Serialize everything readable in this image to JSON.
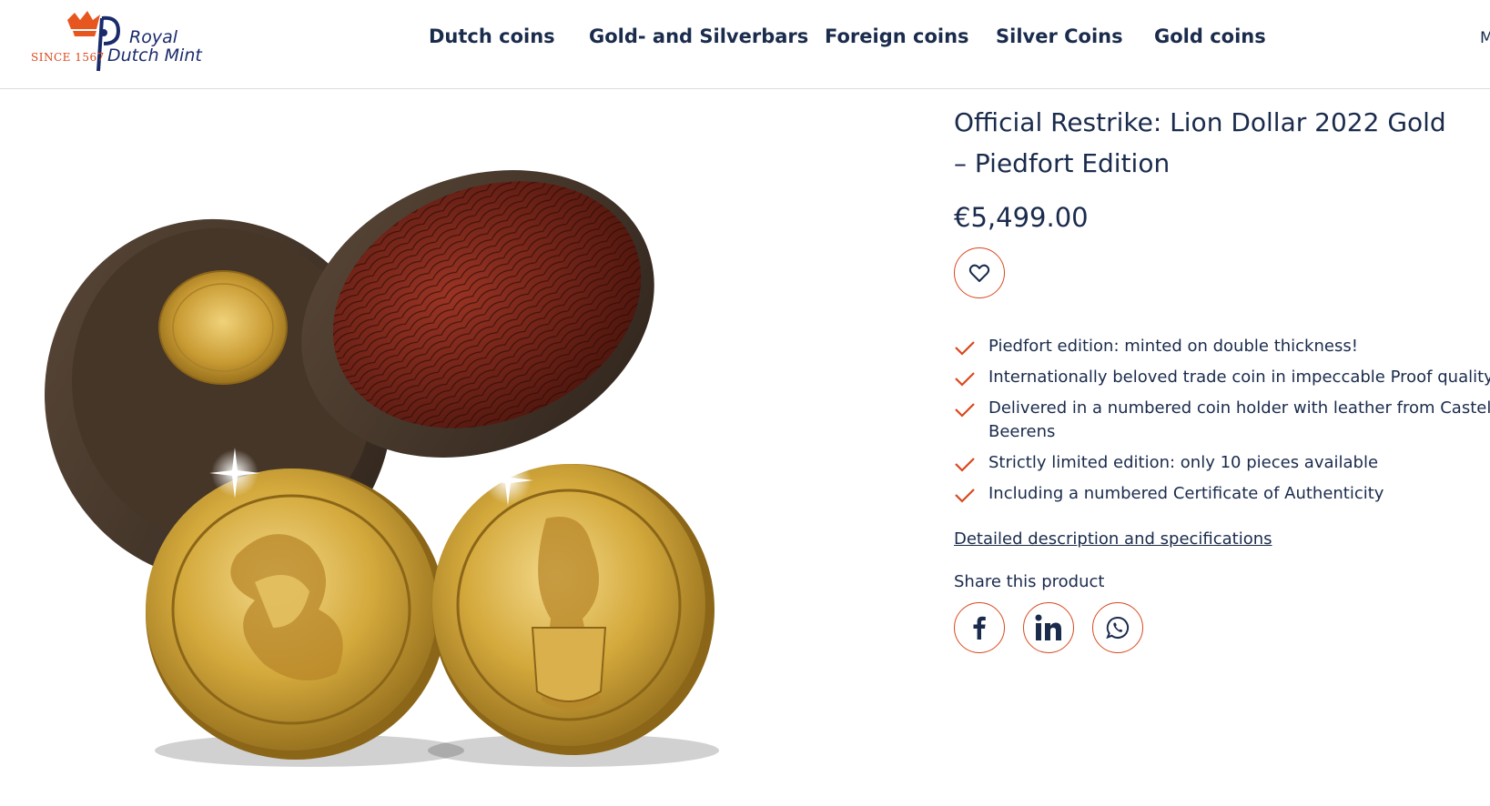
{
  "header": {
    "logo": {
      "since": "SINCE 1567",
      "line1": "Royal",
      "line2": "Dutch Mint"
    },
    "nav": [
      {
        "label": "Dutch coins"
      },
      {
        "label": "Gold- and Silverbars"
      },
      {
        "label": "Foreign coins"
      },
      {
        "label": "Silver Coins"
      },
      {
        "label": "Gold coins"
      }
    ],
    "nav_more": "M"
  },
  "product": {
    "title": "Official Restrike: Lion Dollar 2022 Gold – Piedfort Edition",
    "price": "€5,499.00",
    "favorite_icon": "heart-icon",
    "usps": [
      "Piedfort edition: minted on double thickness!",
      "Internationally beloved trade coin in impeccable Proof quality",
      "Delivered in a numbered coin holder with leather from Casteli Beerens",
      "Strictly limited edition: only 10 pieces available",
      "Including a numbered Certificate of Authenticity"
    ],
    "details_link": "Detailed description and specifications",
    "share_label": "Share this product",
    "share_icons": [
      "facebook-icon",
      "linkedin-icon",
      "whatsapp-icon"
    ]
  },
  "colors": {
    "accent": "#d9481c",
    "text": "#1a2b4c",
    "gold": "#d4a93c",
    "wood": "#4a3a2e",
    "leather": "#7a2418"
  }
}
